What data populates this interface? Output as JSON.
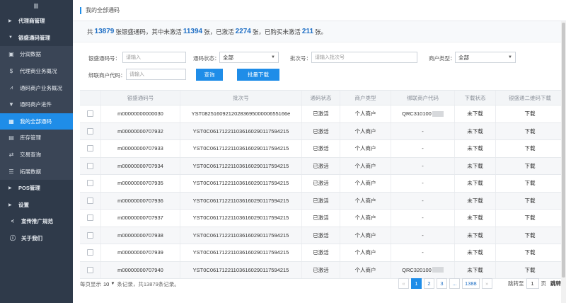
{
  "sidebar": {
    "toggle_icon": "menu-icon",
    "items": [
      {
        "label": "代理商管理",
        "type": "group",
        "icon": "caret-right"
      },
      {
        "label": "银盛通码管理",
        "type": "group-open",
        "icon": "caret-down"
      },
      {
        "label": "分润数据",
        "type": "sub",
        "icon": "chart-icon"
      },
      {
        "label": "代理商业务概况",
        "type": "sub",
        "icon": "dollar-chart-icon"
      },
      {
        "label": "通码商户业务概况",
        "type": "sub",
        "icon": "trend-icon"
      },
      {
        "label": "通码商户进件",
        "type": "sub",
        "icon": "cart-icon"
      },
      {
        "label": "我的全部通码",
        "type": "sub-active",
        "icon": "grid-icon"
      },
      {
        "label": "库存管理",
        "type": "sub",
        "icon": "briefcase-icon"
      },
      {
        "label": "交易查询",
        "type": "sub",
        "icon": "exchange-icon"
      },
      {
        "label": "拓展数据",
        "type": "sub",
        "icon": "list-icon"
      },
      {
        "label": "POS管理",
        "type": "group",
        "icon": "caret-right"
      },
      {
        "label": "设置",
        "type": "group",
        "icon": "caret-right"
      },
      {
        "label": "宣传推广规范",
        "type": "top",
        "icon": "share-icon"
      },
      {
        "label": "关于我们",
        "type": "top",
        "icon": "info-icon"
      }
    ]
  },
  "breadcrumb": "我的全部通码",
  "summary": {
    "p1": "共",
    "total": "13879",
    "p2": "张银盛通码，其中未激活",
    "inactive": "11394",
    "p3": "张，已激活",
    "active": "2274",
    "p4": "张，已购买未激活",
    "bought": "211",
    "p5": "张。"
  },
  "filters": {
    "code_label": "银盛通码号：",
    "code_placeholder": "请输入",
    "status_label": "通码状态：",
    "status_value": "全部",
    "batch_label": "批次号：",
    "batch_placeholder": "请输入批次号",
    "merchant_type_label": "商户类型：",
    "merchant_type_value": "全部",
    "merchant_code_label": "绑联商户代码：",
    "merchant_code_placeholder": "请输入",
    "query_button": "查询",
    "batch_download_button": "批量下载"
  },
  "table": {
    "headers": [
      "",
      "银盛通码号",
      "批次号",
      "通码状态",
      "商户类型",
      "绑联商户代码",
      "下载状态",
      "银盛通二维码下载"
    ],
    "rows": [
      {
        "code": "m00000000000030",
        "batch": "YST08251609212028369500000655166e",
        "status": "已激活",
        "mtype": "个人商户",
        "merchant": "QRC310100",
        "dl_status": "未下载",
        "download": "下载"
      },
      {
        "code": "m00000000707932",
        "batch": "YST0C061712211036160290117594215",
        "status": "已激活",
        "mtype": "个人商户",
        "merchant": "-",
        "dl_status": "未下载",
        "download": "下载"
      },
      {
        "code": "m00000000707933",
        "batch": "YST0C061712211036160290117594215",
        "status": "已激活",
        "mtype": "个人商户",
        "merchant": "-",
        "dl_status": "未下载",
        "download": "下载"
      },
      {
        "code": "m00000000707934",
        "batch": "YST0C061712211036160290117594215",
        "status": "已激活",
        "mtype": "个人商户",
        "merchant": "-",
        "dl_status": "未下载",
        "download": "下载"
      },
      {
        "code": "m00000000707935",
        "batch": "YST0C061712211036160290117594215",
        "status": "已激活",
        "mtype": "个人商户",
        "merchant": "-",
        "dl_status": "未下载",
        "download": "下载"
      },
      {
        "code": "m00000000707936",
        "batch": "YST0C061712211036160290117594215",
        "status": "已激活",
        "mtype": "个人商户",
        "merchant": "-",
        "dl_status": "未下载",
        "download": "下载"
      },
      {
        "code": "m00000000707937",
        "batch": "YST0C061712211036160290117594215",
        "status": "已激活",
        "mtype": "个人商户",
        "merchant": "-",
        "dl_status": "未下载",
        "download": "下载"
      },
      {
        "code": "m00000000707938",
        "batch": "YST0C061712211036160290117594215",
        "status": "已激活",
        "mtype": "个人商户",
        "merchant": "-",
        "dl_status": "未下载",
        "download": "下载"
      },
      {
        "code": "m00000000707939",
        "batch": "YST0C061712211036160290117594215",
        "status": "已激活",
        "mtype": "个人商户",
        "merchant": "-",
        "dl_status": "未下载",
        "download": "下载"
      },
      {
        "code": "m00000000707940",
        "batch": "YST0C061712211036160290117594215",
        "status": "已激活",
        "mtype": "个人商户",
        "merchant": "QRC320100",
        "dl_status": "未下载",
        "download": "下载"
      }
    ]
  },
  "pagination": {
    "per_page_label": "每页显示",
    "per_page_value": "10",
    "records_text": "条记录，共13879条记录。",
    "pages": [
      "«",
      "1",
      "2",
      "3",
      "...",
      "1388",
      "»"
    ],
    "current": "1",
    "jump_label": "跳转至",
    "jump_value": "1",
    "page_unit": "页",
    "go_label": "跳转"
  },
  "colors": {
    "sidebar_bg": "#2f3a4a",
    "accent": "#1f8de8",
    "number_blue": "#1f6fc5"
  }
}
